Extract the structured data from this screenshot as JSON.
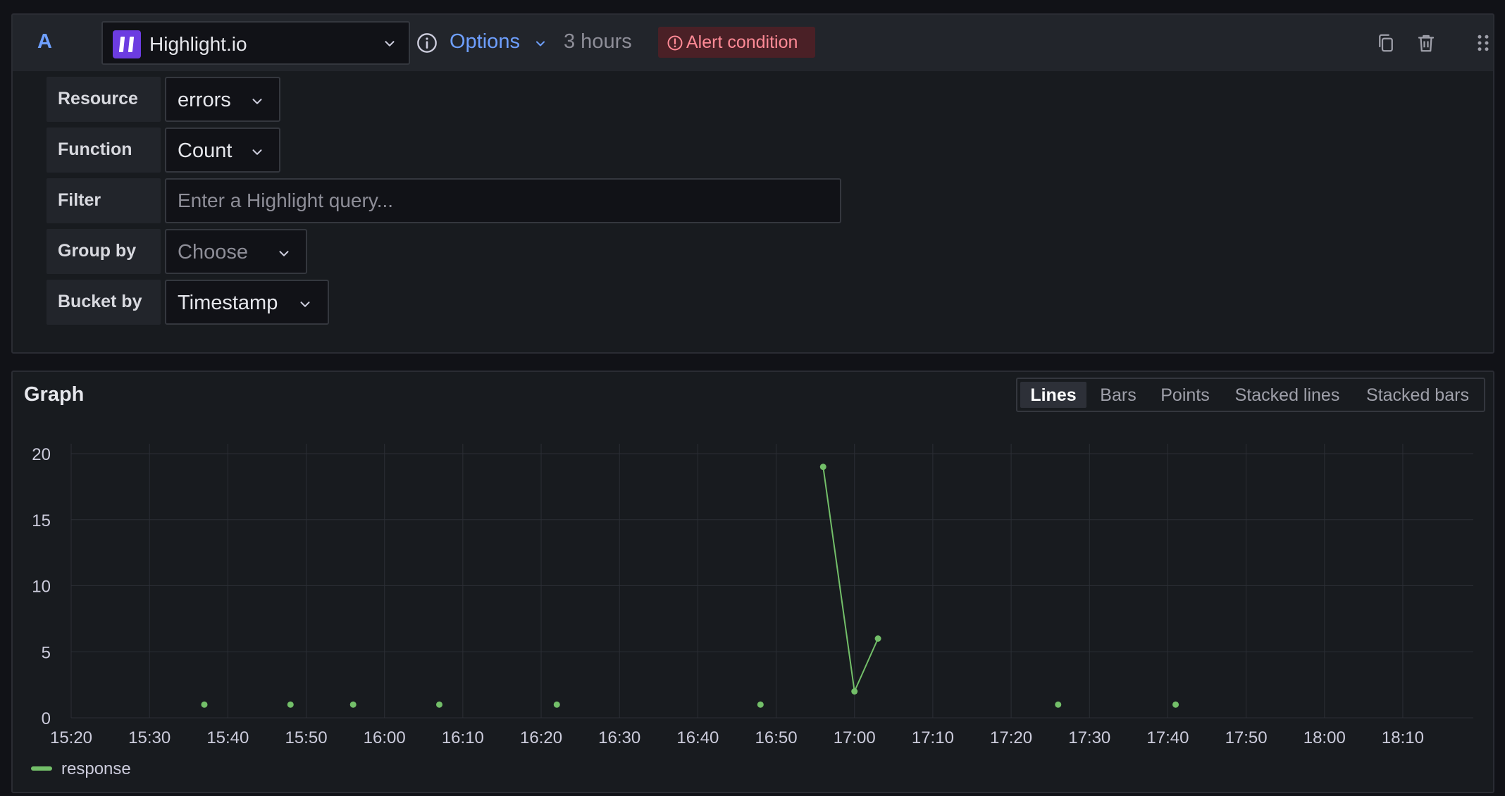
{
  "query": {
    "ref_id": "A",
    "datasource": {
      "name": "Highlight.io",
      "logo_color": "#6c3ce1"
    },
    "options_label": "Options",
    "time_range": "3 hours",
    "alert_label": "Alert condition",
    "fields": {
      "resource": {
        "label": "Resource",
        "value": "errors"
      },
      "function": {
        "label": "Function",
        "value": "Count"
      },
      "filter": {
        "label": "Filter",
        "placeholder": "Enter a Highlight query..."
      },
      "group_by": {
        "label": "Group by",
        "placeholder": "Choose"
      },
      "bucket_by": {
        "label": "Bucket by",
        "value": "Timestamp"
      }
    },
    "header_icons": [
      "duplicate-icon",
      "trash-icon",
      "drag-handle-icon"
    ]
  },
  "graph": {
    "title": "Graph",
    "viz_types": [
      {
        "label": "Lines",
        "active": true
      },
      {
        "label": "Bars",
        "active": false
      },
      {
        "label": "Points",
        "active": false
      },
      {
        "label": "Stacked lines",
        "active": false
      },
      {
        "label": "Stacked bars",
        "active": false
      }
    ]
  },
  "colors": {
    "accent": "#6e9fff",
    "series": "#73bf69",
    "alert": "#ff8a96"
  },
  "chart_data": {
    "type": "line",
    "x_tick_labels": [
      "15:20",
      "15:30",
      "15:40",
      "15:50",
      "16:00",
      "16:10",
      "16:20",
      "16:30",
      "16:40",
      "16:50",
      "17:00",
      "17:10",
      "17:20",
      "17:30",
      "17:40",
      "17:50",
      "18:00",
      "18:10"
    ],
    "y_ticks": [
      0,
      5,
      10,
      15,
      20
    ],
    "ylim": [
      0,
      20
    ],
    "xlim": [
      "15:20",
      "18:19"
    ],
    "grid": true,
    "legend_position": "bottom-left",
    "series": [
      {
        "name": "response",
        "color": "#73bf69",
        "points": [
          {
            "x": "15:37",
            "y": 1
          },
          {
            "x": "15:48",
            "y": 1
          },
          {
            "x": "15:56",
            "y": 1
          },
          {
            "x": "16:07",
            "y": 1
          },
          {
            "x": "16:22",
            "y": 1
          },
          {
            "x": "16:48",
            "y": 1
          },
          {
            "x": "16:56",
            "y": 19
          },
          {
            "x": "17:00",
            "y": 2
          },
          {
            "x": "17:03",
            "y": 6
          },
          {
            "x": "17:26",
            "y": 1
          },
          {
            "x": "17:41",
            "y": 1
          }
        ]
      }
    ]
  }
}
